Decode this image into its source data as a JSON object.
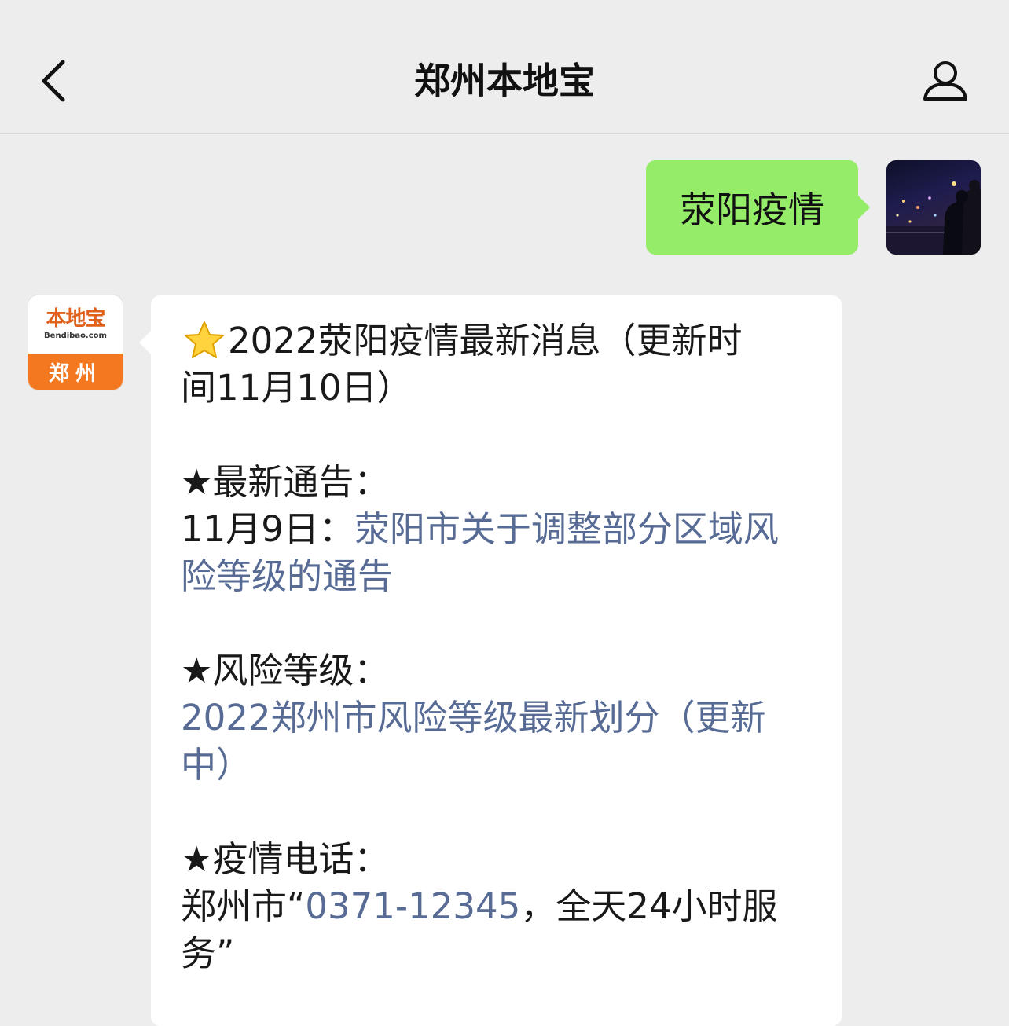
{
  "header": {
    "title": "郑州本地宝"
  },
  "chat": {
    "outgoing": {
      "text": "荥阳疫情"
    },
    "sender_logo": {
      "cn": "本地宝",
      "en": "Bendibao.com",
      "city": "郑州"
    },
    "incoming": {
      "headline_1": "2022荥阳疫情最新消息（更新时",
      "headline_2": "间11月10日）",
      "notice_heading": "★最新通告：",
      "notice_date": "11月9日：",
      "notice_link_1": "荥阳市关于调整部分区域风",
      "notice_link_2": "险等级的通告",
      "risk_heading": "★风险等级：",
      "risk_link_1": "2022郑州市风险等级最新划分（更新",
      "risk_link_2": "中）",
      "phone_heading": "★疫情电话：",
      "phone_prefix": "郑州市“",
      "phone_number": "0371-12345",
      "phone_suffix": "，全天24小时服",
      "phone_tail": "务”"
    }
  },
  "colors": {
    "background": "#ededed",
    "outgoing_bubble": "#95ec69",
    "incoming_bubble": "#ffffff",
    "link": "#576b95",
    "brand_orange": "#f4781f"
  }
}
